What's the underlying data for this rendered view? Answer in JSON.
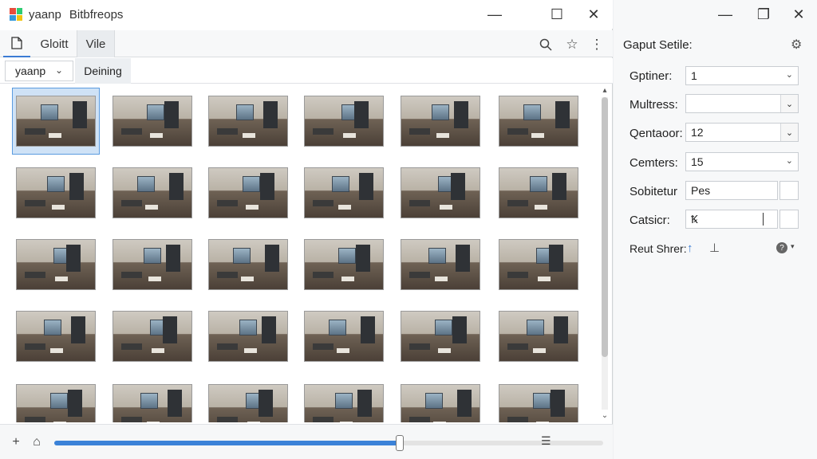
{
  "window": {
    "title_part1": "yaanp",
    "title_part2": "Bitbfreops",
    "minimize_glyph": "—",
    "maximize_glyph": "☐",
    "close_glyph": "✕"
  },
  "tabs": [
    {
      "label": "Gloitt",
      "active": false
    },
    {
      "label": "Vile",
      "active": true
    }
  ],
  "toolbar_icons": [
    "search-icon",
    "star-icon",
    "more-icon"
  ],
  "subbar": {
    "dropdown_value": "yaanp",
    "label": "Deining"
  },
  "thumbnails": {
    "rows": 5,
    "cols": 6,
    "selected_index": 0
  },
  "bottombar": {
    "slider_value_fraction": 0.63
  },
  "side_panel": {
    "title": "Gaput Setile:",
    "minimize_glyph": "—",
    "maximize_glyph": "❐",
    "close_glyph": "✕",
    "properties": [
      {
        "label": "Gptiner:",
        "value": "1",
        "kind": "select"
      },
      {
        "label": "Multress:",
        "value": "",
        "kind": "combo"
      },
      {
        "label": "Qentaoor:",
        "value": "12",
        "kind": "combo"
      },
      {
        "label": "Cemters:",
        "value": "15",
        "kind": "select"
      },
      {
        "label": "Sobitetur",
        "value": "Pes",
        "kind": "split"
      },
      {
        "label": "Catsicr:",
        "value": "Ꝅ",
        "kind": "split"
      }
    ],
    "reset_label": "Reut Shrer:"
  },
  "colors": {
    "accent": "#3b82d8",
    "selection": "#cfe2f6"
  }
}
